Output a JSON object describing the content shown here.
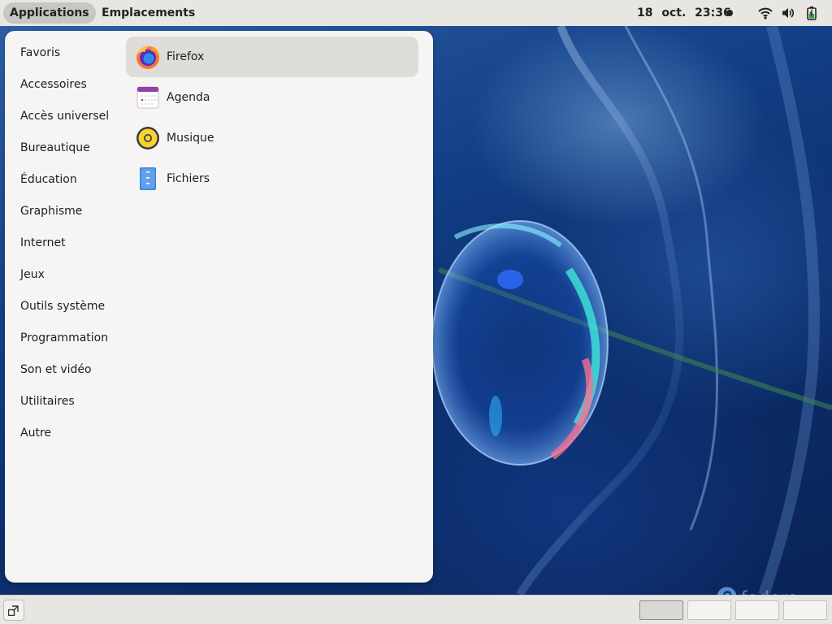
{
  "top_bar": {
    "applications_label": "Applications",
    "places_label": "Emplacements",
    "clock": "18 oct.  23:36",
    "tray_icons": [
      "wifi-icon",
      "volume-icon",
      "battery-icon"
    ]
  },
  "menu": {
    "categories": [
      {
        "label": "Favoris"
      },
      {
        "label": "Accessoires"
      },
      {
        "label": "Accès universel"
      },
      {
        "label": "Bureautique"
      },
      {
        "label": "Éducation"
      },
      {
        "label": "Graphisme"
      },
      {
        "label": "Internet"
      },
      {
        "label": "Jeux"
      },
      {
        "label": "Outils système"
      },
      {
        "label": "Programmation"
      },
      {
        "label": "Son et vidéo"
      },
      {
        "label": "Utilitaires"
      },
      {
        "label": "Autre"
      }
    ],
    "apps": [
      {
        "label": "Firefox",
        "icon": "firefox-icon",
        "selected": true
      },
      {
        "label": "Agenda",
        "icon": "calendar-icon",
        "selected": false
      },
      {
        "label": "Musique",
        "icon": "music-icon",
        "selected": false
      },
      {
        "label": "Fichiers",
        "icon": "files-icon",
        "selected": false
      }
    ]
  },
  "desktop": {
    "logo_text": "fedora"
  },
  "bottom_bar": {
    "workspaces": 4,
    "active_workspace": 1
  },
  "colors": {
    "panel_bg": "#f6f5f4",
    "bar_bg": "#e8e6e3",
    "selected_bg": "#deddda",
    "wallpaper_dark": "#0a2356",
    "fedora_blue": "#5a8ad0"
  }
}
